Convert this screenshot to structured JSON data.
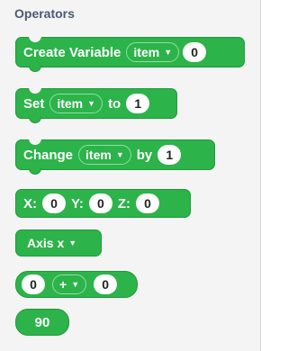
{
  "category": {
    "title": "Operators"
  },
  "blocks": {
    "create_variable": {
      "label": "Create Variable",
      "dropdown": "item",
      "value": "0"
    },
    "set": {
      "label": "Set",
      "dropdown": "item",
      "to_label": "to",
      "value": "1"
    },
    "change": {
      "label": "Change",
      "dropdown": "item",
      "by_label": "by",
      "value": "1"
    },
    "xyz": {
      "x_label": "X:",
      "x_value": "0",
      "y_label": "Y:",
      "y_value": "0",
      "z_label": "Z:",
      "z_value": "0"
    },
    "axis": {
      "dropdown": "Axis x"
    },
    "math": {
      "left": "0",
      "operator": "+",
      "right": "0"
    },
    "number": {
      "value": "90"
    }
  },
  "colors": {
    "block_green": "#2cb34a",
    "title_text": "#4a5a73"
  },
  "icons": {
    "dropdown_caret": "caret-down-icon"
  }
}
